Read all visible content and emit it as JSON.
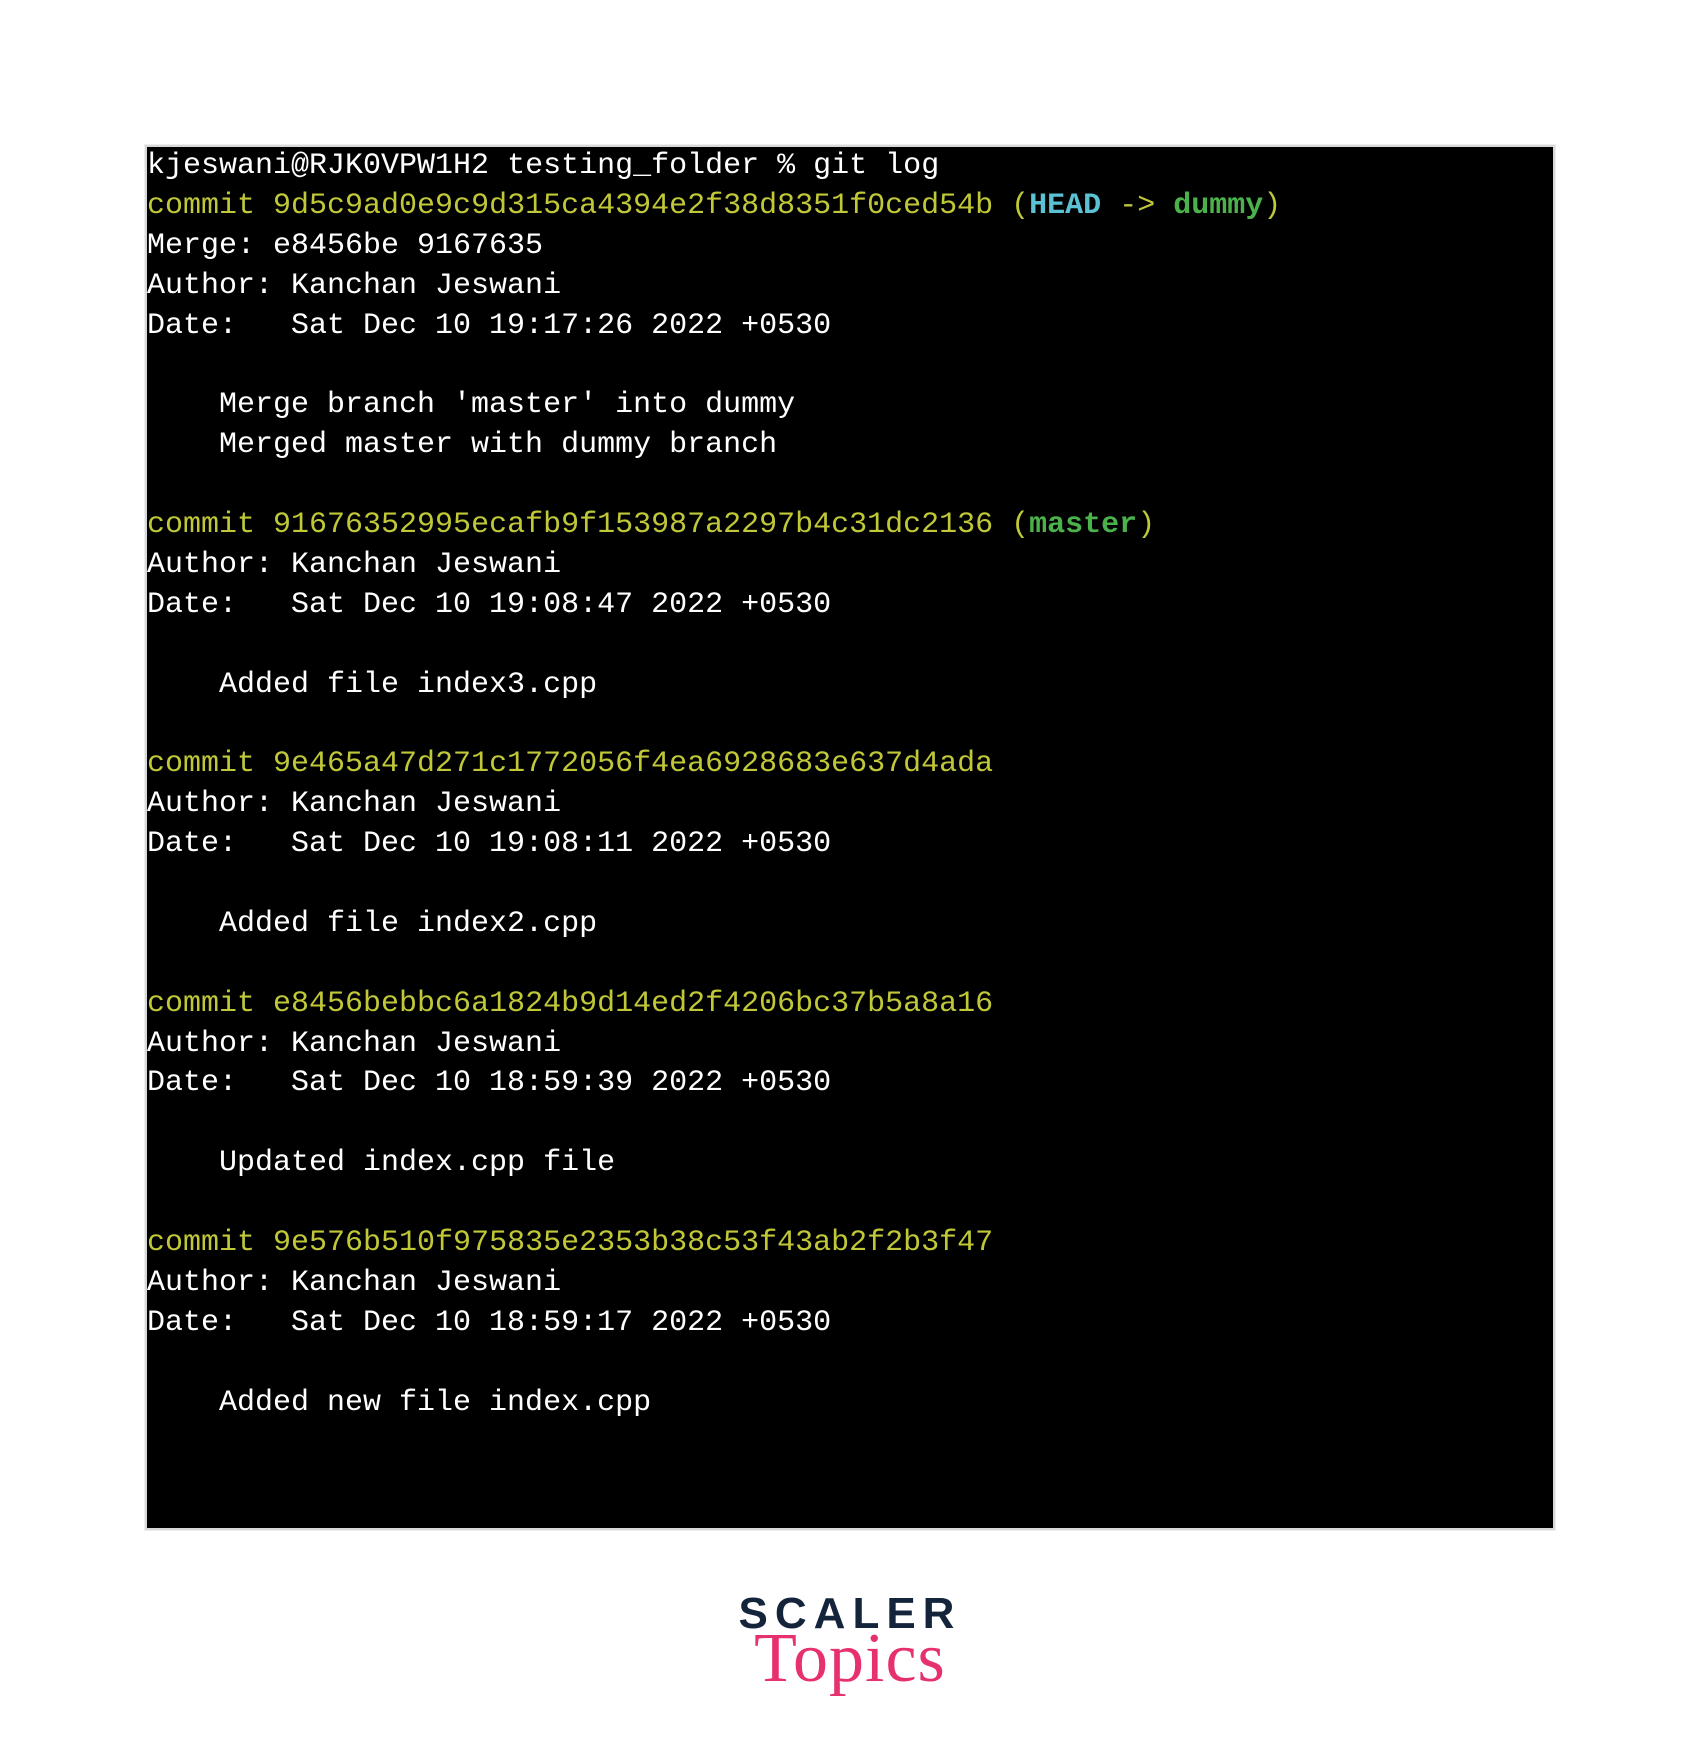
{
  "terminal": {
    "prompt_user": "kjeswani@RJK0VPW1H2",
    "prompt_dir": "testing_folder",
    "prompt_symbol": "%",
    "command": "git log",
    "commits": [
      {
        "hash": "9d5c9ad0e9c9d315ca4394e2f38d8351f0ced54b",
        "ref_head": "HEAD",
        "ref_arrow": "->",
        "ref_branch": "dummy",
        "merge": "Merge: e8456be 9167635",
        "author": "Author: Kanchan Jeswani",
        "date": "Date:   Sat Dec 10 19:17:26 2022 +0530",
        "msg1": "    Merge branch 'master' into dummy",
        "msg2": "    Merged master with dummy branch"
      },
      {
        "hash": "91676352995ecafb9f153987a2297b4c31dc2136",
        "ref_branch": "master",
        "author": "Author: Kanchan Jeswani",
        "date": "Date:   Sat Dec 10 19:08:47 2022 +0530",
        "msg1": "    Added file index3.cpp"
      },
      {
        "hash": "9e465a47d271c1772056f4ea6928683e637d4ada",
        "author": "Author: Kanchan Jeswani",
        "date": "Date:   Sat Dec 10 19:08:11 2022 +0530",
        "msg1": "    Added file index2.cpp"
      },
      {
        "hash": "e8456bebbc6a1824b9d14ed2f4206bc37b5a8a16",
        "author": "Author: Kanchan Jeswani",
        "date": "Date:   Sat Dec 10 18:59:39 2022 +0530",
        "msg1": "    Updated index.cpp file"
      },
      {
        "hash": "9e576b510f975835e2353b38c53f43ab2f2b3f47",
        "author": "Author: Kanchan Jeswani",
        "date": "Date:   Sat Dec 10 18:59:17 2022 +0530",
        "msg1": "    Added new file index.cpp"
      }
    ]
  },
  "logo": {
    "line1": "SCALER",
    "line2": "Topics"
  },
  "labels": {
    "commit_word": "commit "
  }
}
